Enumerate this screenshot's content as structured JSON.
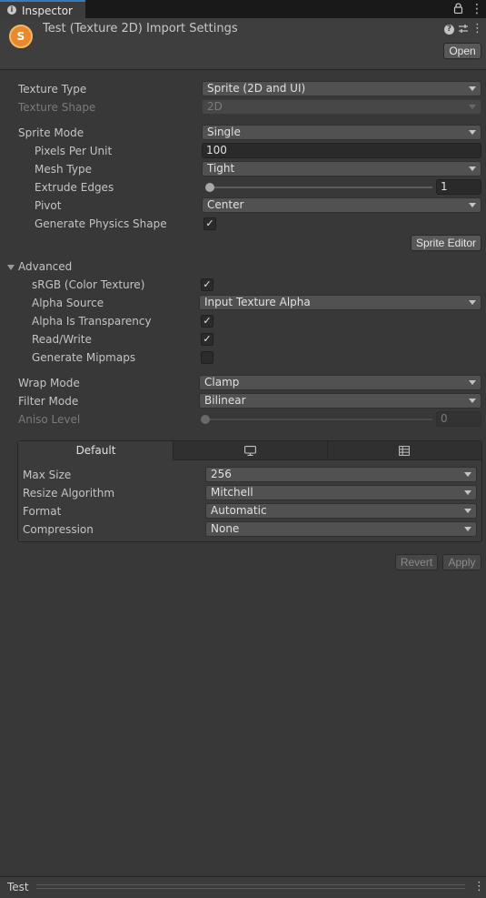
{
  "window": {
    "tab_label": "Inspector",
    "tab_icon": "info-icon",
    "menu_icon": "kebab-menu-icon",
    "lock_icon": "lock-icon"
  },
  "header": {
    "title": "Test (Texture 2D) Import Settings",
    "open_label": "Open",
    "asset_icon": "sprite-asset-icon",
    "help_icon": "help-icon",
    "preset_icon": "preset-sliders-icon"
  },
  "settings": {
    "texture_type": {
      "label": "Texture Type",
      "value": "Sprite (2D and UI)"
    },
    "texture_shape": {
      "label": "Texture Shape",
      "value": "2D"
    },
    "sprite_mode": {
      "label": "Sprite Mode",
      "value": "Single"
    },
    "pixels_per_unit": {
      "label": "Pixels Per Unit",
      "value": "100"
    },
    "mesh_type": {
      "label": "Mesh Type",
      "value": "Tight"
    },
    "extrude_edges": {
      "label": "Extrude Edges",
      "value": "1",
      "slider_fraction": 0.0
    },
    "pivot": {
      "label": "Pivot",
      "value": "Center"
    },
    "generate_physics_shape": {
      "label": "Generate Physics Shape",
      "checked": true
    },
    "sprite_editor_label": "Sprite Editor"
  },
  "advanced": {
    "label": "Advanced",
    "srgb": {
      "label": "sRGB (Color Texture)",
      "checked": true
    },
    "alpha_source": {
      "label": "Alpha Source",
      "value": "Input Texture Alpha"
    },
    "alpha_is_transparency": {
      "label": "Alpha Is Transparency",
      "checked": true
    },
    "read_write": {
      "label": "Read/Write",
      "checked": true
    },
    "generate_mipmaps": {
      "label": "Generate Mipmaps",
      "checked": false
    }
  },
  "sampling": {
    "wrap_mode": {
      "label": "Wrap Mode",
      "value": "Clamp"
    },
    "filter_mode": {
      "label": "Filter Mode",
      "value": "Bilinear"
    },
    "aniso_level": {
      "label": "Aniso Level",
      "value": "0",
      "slider_fraction": 0.0
    }
  },
  "platform": {
    "tabs": [
      {
        "label": "Default",
        "active": true
      },
      {
        "icon": "standalone-monitor-icon",
        "active": false
      },
      {
        "icon": "webgl-grid-icon",
        "active": false
      }
    ],
    "max_size": {
      "label": "Max Size",
      "value": "256"
    },
    "resize_algorithm": {
      "label": "Resize Algorithm",
      "value": "Mitchell"
    },
    "format": {
      "label": "Format",
      "value": "Automatic"
    },
    "compression": {
      "label": "Compression",
      "value": "None"
    }
  },
  "actions": {
    "revert_label": "Revert",
    "apply_label": "Apply"
  },
  "footer": {
    "label": "Test"
  },
  "colors": {
    "panel_bg": "#383838",
    "accent_tab": "#3a79bb",
    "asset_orange": "#e88a2c"
  }
}
